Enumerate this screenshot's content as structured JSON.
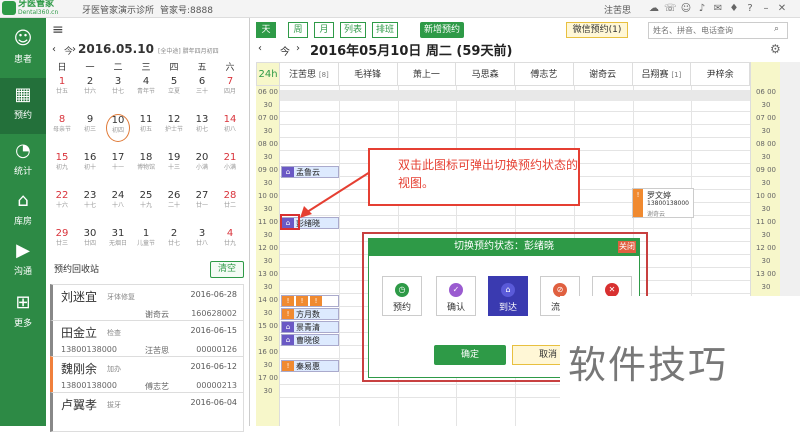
{
  "titlebar": {
    "logo": "牙医管家",
    "logo_sub": "Dental360.cn",
    "clinic": "牙医管家演示诊所",
    "manager_id": "管家号:8888",
    "user": "注苦思"
  },
  "sidebar": {
    "items": [
      {
        "label": "患者",
        "icon": "patient-icon"
      },
      {
        "label": "预约",
        "icon": "calendar-icon"
      },
      {
        "label": "统计",
        "icon": "pie-chart-icon"
      },
      {
        "label": "库房",
        "icon": "warehouse-icon"
      },
      {
        "label": "沟通",
        "icon": "play-icon"
      },
      {
        "label": "更多",
        "icon": "grid-icon"
      }
    ]
  },
  "calendar": {
    "today_label": "今",
    "month": "2016.05.10",
    "lunar": "[全中途] 腊年四月初四",
    "weekdays": [
      "日",
      "一",
      "二",
      "三",
      "四",
      "五",
      "六"
    ],
    "weeks": [
      [
        {
          "d": "1",
          "l": "廿五"
        },
        {
          "d": "2",
          "l": "廿六"
        },
        {
          "d": "3",
          "l": "廿七"
        },
        {
          "d": "4",
          "l": "青年节"
        },
        {
          "d": "5",
          "l": "立夏"
        },
        {
          "d": "6",
          "l": "三十"
        },
        {
          "d": "7",
          "l": "四月"
        }
      ],
      [
        {
          "d": "8",
          "l": "母亲节"
        },
        {
          "d": "9",
          "l": "初三"
        },
        {
          "d": "10",
          "l": "初四"
        },
        {
          "d": "11",
          "l": "初五"
        },
        {
          "d": "12",
          "l": "护士节"
        },
        {
          "d": "13",
          "l": "初七"
        },
        {
          "d": "14",
          "l": "初八"
        }
      ],
      [
        {
          "d": "15",
          "l": "初九"
        },
        {
          "d": "16",
          "l": "初十"
        },
        {
          "d": "17",
          "l": "十一"
        },
        {
          "d": "18",
          "l": "博物馆"
        },
        {
          "d": "19",
          "l": "十三"
        },
        {
          "d": "20",
          "l": "小满"
        },
        {
          "d": "21",
          "l": "小满"
        }
      ],
      [
        {
          "d": "22",
          "l": "十六"
        },
        {
          "d": "23",
          "l": "十七"
        },
        {
          "d": "24",
          "l": "十八"
        },
        {
          "d": "25",
          "l": "十九"
        },
        {
          "d": "26",
          "l": "二十"
        },
        {
          "d": "27",
          "l": "廿一"
        },
        {
          "d": "28",
          "l": "廿二"
        }
      ],
      [
        {
          "d": "29",
          "l": "廿三"
        },
        {
          "d": "30",
          "l": "廿四"
        },
        {
          "d": "31",
          "l": "无烟日"
        },
        {
          "d": "1",
          "l": "儿童节"
        },
        {
          "d": "2",
          "l": "廿七"
        },
        {
          "d": "3",
          "l": "廿八"
        },
        {
          "d": "4",
          "l": "廿九"
        }
      ]
    ]
  },
  "recycle": {
    "title": "预约回收站",
    "clear": "清空",
    "cards": [
      {
        "name": "刘迷宜",
        "tag": "牙体修复",
        "date": "2016-06-28",
        "phone": "",
        "doctor": "谢奇云",
        "code": "160628002",
        "accent": "#888888"
      },
      {
        "name": "田金立",
        "tag": "检查",
        "date": "2016-06-15",
        "phone": "13800138000",
        "doctor": "汪苦思",
        "code": "00000126",
        "accent": "#888888"
      },
      {
        "name": "魏刚余",
        "tag": "加办",
        "date": "2016-06-12",
        "phone": "13800138000",
        "doctor": "傅志艺",
        "code": "00000213",
        "accent": "#f0803c"
      },
      {
        "name": "卢翼孝",
        "tag": "拔牙",
        "date": "2016-06-04",
        "phone": "",
        "doctor": "",
        "code": "",
        "accent": "#888888"
      }
    ]
  },
  "toolbar": {
    "views": [
      "天",
      "周",
      "月",
      "列表",
      "排班"
    ],
    "new_appt": "新增预约",
    "wechat": "微信预约(1)",
    "search_placeholder": "姓名、拼音、电话查询"
  },
  "schedule": {
    "today_btn": "今",
    "date_title": "2016年05月10日 周二 (59天前)",
    "h24": "24h",
    "doctors": [
      {
        "name": "汪苦思",
        "count": "[8]"
      },
      {
        "name": "毛祥锋",
        "count": ""
      },
      {
        "name": "萧上一",
        "count": ""
      },
      {
        "name": "马思森",
        "count": ""
      },
      {
        "name": "傅志艺",
        "count": ""
      },
      {
        "name": "谢奇云",
        "count": ""
      },
      {
        "name": "吕翔赛",
        "count": "[1]"
      },
      {
        "name": "尹梓余",
        "count": ""
      }
    ],
    "times": [
      "06 00",
      "30",
      "07 00",
      "30",
      "08 00",
      "30",
      "09 00",
      "30",
      "10 00",
      "30",
      "11 00",
      "30",
      "12 00",
      "30",
      "13 00",
      "30",
      "14 00",
      "30",
      "15 00",
      "30",
      "16 00",
      "30",
      "17 00",
      "30"
    ],
    "appointments": [
      {
        "name": "孟鲁云"
      },
      {
        "name": "彭绪晓"
      },
      {
        "name": "方月数"
      },
      {
        "name": "景青清"
      },
      {
        "name": "曹晓俊"
      },
      {
        "name": "秦易惠"
      }
    ],
    "right_appt": {
      "name": "罗文婷",
      "phone": "13800138000",
      "tag": "谢奇云"
    }
  },
  "callout": {
    "text": "双击此图标可弹出切换预约状态的视图。"
  },
  "dialog": {
    "title": "切换预约状态：彭绪晓",
    "close": "关闭",
    "buttons": [
      {
        "label": "预约",
        "color": "#2e9a47"
      },
      {
        "label": "确认",
        "color": "#9a5bd0"
      },
      {
        "label": "到达",
        "color": "#3a3ab0"
      },
      {
        "label": "流失",
        "color": "#e06040"
      },
      {
        "label": "删除",
        "color": "#d83030"
      }
    ],
    "ok": "确定",
    "cancel": "取消"
  },
  "watermark": "软件技巧"
}
